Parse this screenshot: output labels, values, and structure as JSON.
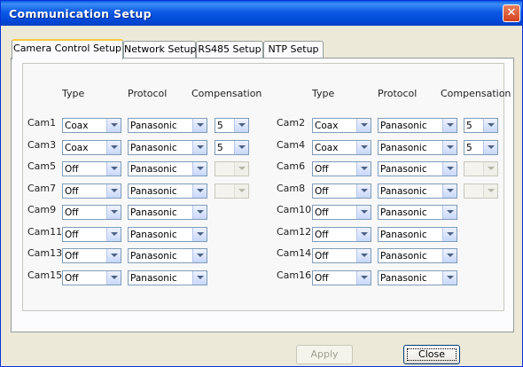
{
  "window": {
    "title": "Communication Setup",
    "close_symbol": "✕"
  },
  "tabs": [
    {
      "label": "Camera Control Setup",
      "active": true
    },
    {
      "label": "Network Setup",
      "active": false
    },
    {
      "label": "RS485 Setup",
      "active": false
    },
    {
      "label": "NTP Setup",
      "active": false
    }
  ],
  "columns": {
    "type": "Type",
    "protocol": "Protocol",
    "compensation": "Compensation"
  },
  "cameras": [
    {
      "label": "Cam1",
      "type": "Coax",
      "protocol": "Panasonic",
      "compensation": "5",
      "comp_enabled": true
    },
    {
      "label": "Cam2",
      "type": "Coax",
      "protocol": "Panasonic",
      "compensation": "5",
      "comp_enabled": true
    },
    {
      "label": "Cam3",
      "type": "Coax",
      "protocol": "Panasonic",
      "compensation": "5",
      "comp_enabled": true
    },
    {
      "label": "Cam4",
      "type": "Coax",
      "protocol": "Panasonic",
      "compensation": "5",
      "comp_enabled": true
    },
    {
      "label": "Cam5",
      "type": "Off",
      "protocol": "Panasonic",
      "compensation": "",
      "comp_enabled": false
    },
    {
      "label": "Cam6",
      "type": "Off",
      "protocol": "Panasonic",
      "compensation": "",
      "comp_enabled": false
    },
    {
      "label": "Cam7",
      "type": "Off",
      "protocol": "Panasonic",
      "compensation": "",
      "comp_enabled": false
    },
    {
      "label": "Cam8",
      "type": "Off",
      "protocol": "Panasonic",
      "compensation": "",
      "comp_enabled": false
    },
    {
      "label": "Cam9",
      "type": "Off",
      "protocol": "Panasonic"
    },
    {
      "label": "Cam10",
      "type": "Off",
      "protocol": "Panasonic"
    },
    {
      "label": "Cam11",
      "type": "Off",
      "protocol": "Panasonic"
    },
    {
      "label": "Cam12",
      "type": "Off",
      "protocol": "Panasonic"
    },
    {
      "label": "Cam13",
      "type": "Off",
      "protocol": "Panasonic"
    },
    {
      "label": "Cam14",
      "type": "Off",
      "protocol": "Panasonic"
    },
    {
      "label": "Cam15",
      "type": "Off",
      "protocol": "Panasonic"
    },
    {
      "label": "Cam16",
      "type": "Off",
      "protocol": "Panasonic"
    }
  ],
  "buttons": {
    "apply": "Apply",
    "close": "Close"
  }
}
